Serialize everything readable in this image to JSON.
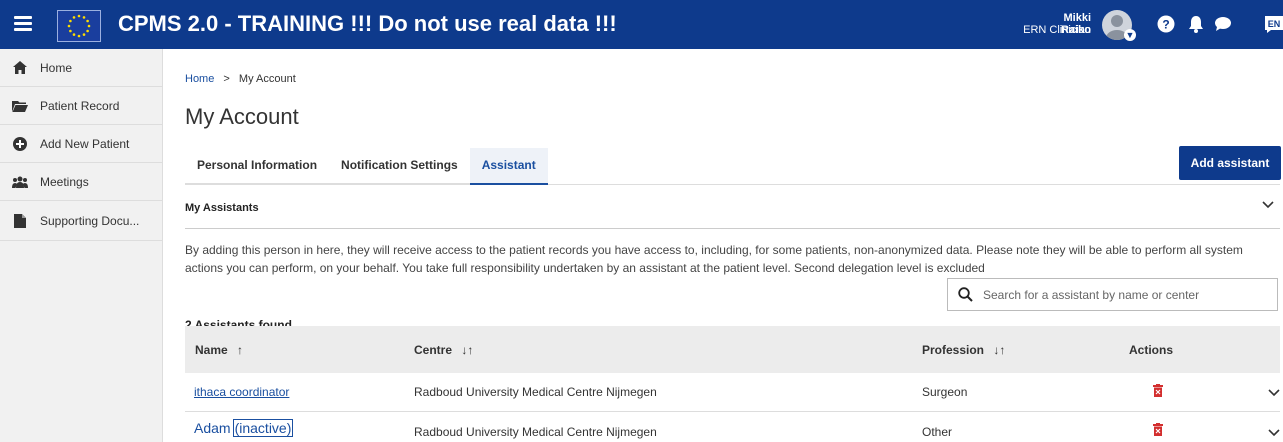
{
  "header": {
    "title": "CPMS 2.0 - TRAINING !!! Do not use real data !!!",
    "user_name": "Mikki Raiko",
    "user_role": "ERN Clinician",
    "lang": "EN"
  },
  "sidebar": {
    "items": [
      {
        "label": "Home",
        "icon": "home-icon"
      },
      {
        "label": "Patient Record",
        "icon": "folder-icon"
      },
      {
        "label": "Add New Patient",
        "icon": "plus-circle-icon"
      },
      {
        "label": "Meetings",
        "icon": "users-icon"
      },
      {
        "label": "Supporting Docu...",
        "icon": "document-icon"
      }
    ]
  },
  "breadcrumb": {
    "home": "Home",
    "sep": ">",
    "current": "My Account"
  },
  "page": {
    "title": "My Account"
  },
  "tabs": [
    {
      "label": "Personal Information"
    },
    {
      "label": "Notification Settings"
    },
    {
      "label": "Assistant",
      "active": true
    }
  ],
  "add_button": "Add assistant",
  "section": {
    "title": "My Assistants",
    "description": "By adding this person in here, they will receive access to the patient records you have access to, including, for some patients, non-anonymized data. Please note they will be able to perform all system actions you can perform, on your behalf. You take full responsibility undertaken by an assistant at the patient level. Second delegation level is excluded",
    "found": "2 Assistants found",
    "search_placeholder": "Search for a assistant by name or center"
  },
  "table": {
    "headers": {
      "name": "Name",
      "centre": "Centre",
      "profession": "Profession",
      "actions": "Actions"
    },
    "rows": [
      {
        "name": "ithaca coordinator",
        "centre": "Radboud University Medical Centre Nijmegen",
        "profession": "Surgeon"
      },
      {
        "name": "Adam",
        "status": "(inactive)",
        "centre": "Radboud University Medical Centre Nijmegen",
        "profession": "Other"
      }
    ]
  },
  "colors": {
    "brand": "#0e3a8c",
    "link": "#1a4fa0",
    "delete": "#d32f2f"
  }
}
